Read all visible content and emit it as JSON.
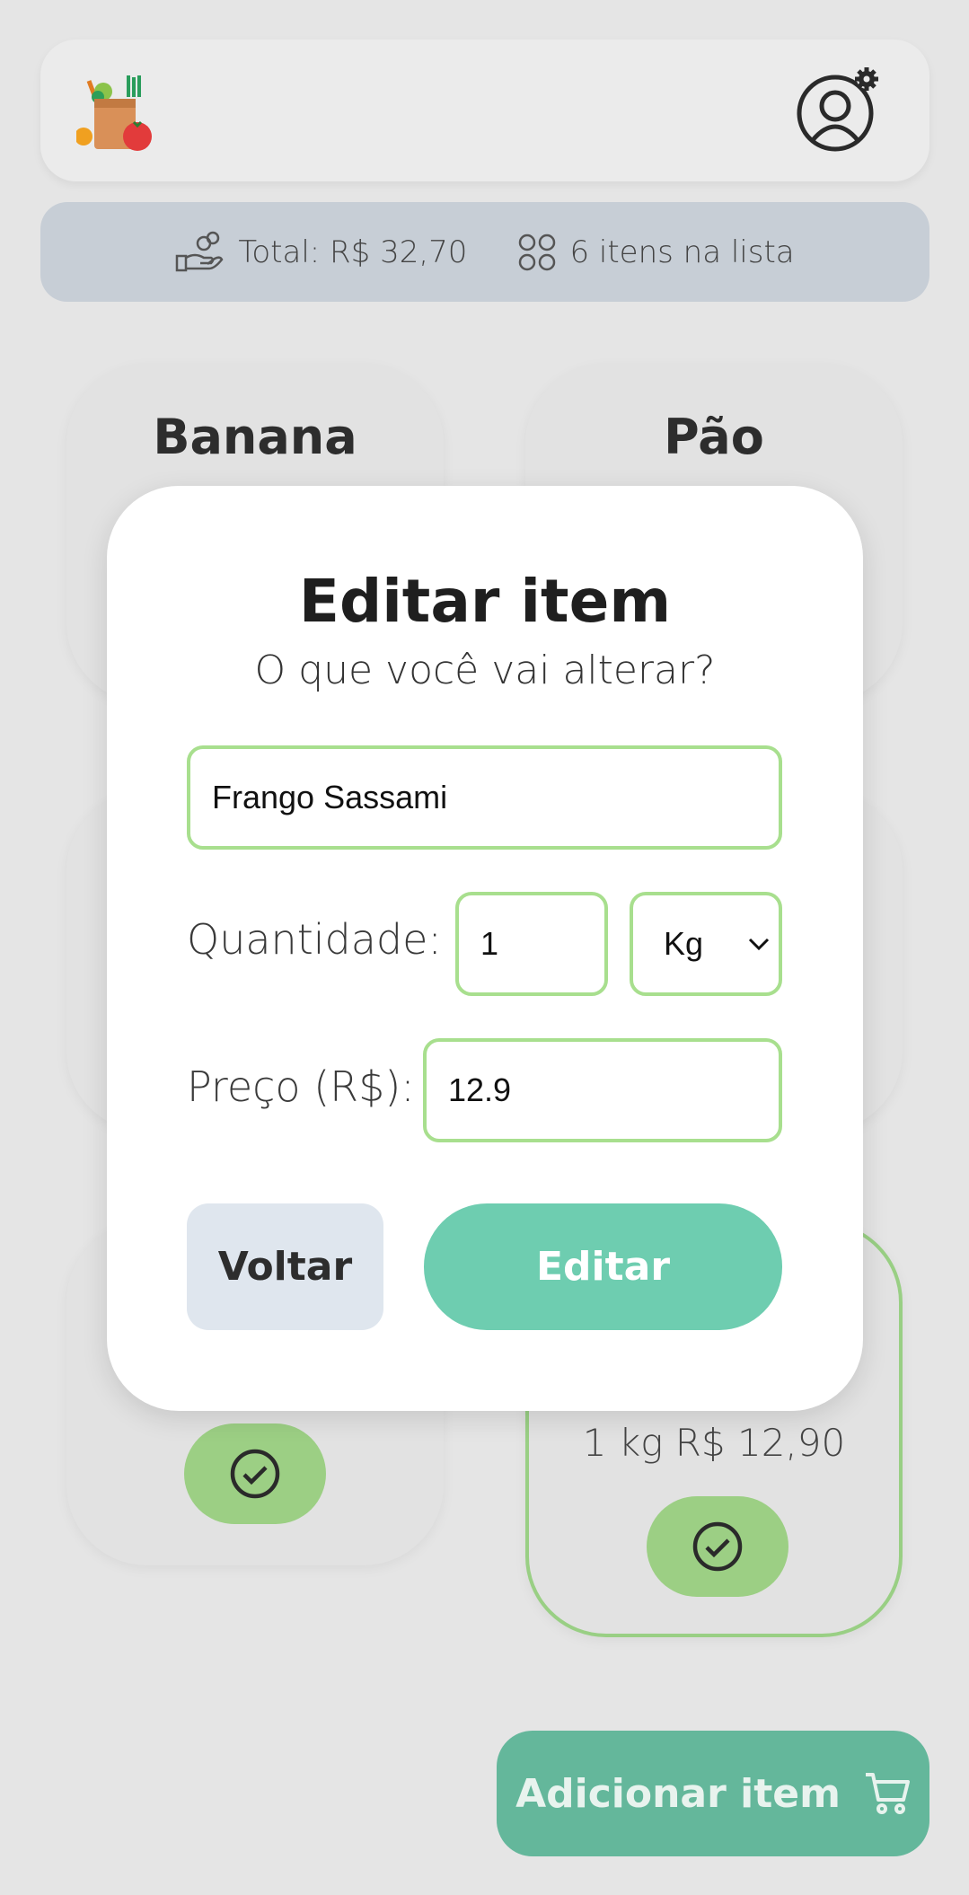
{
  "summary": {
    "total": "Total: R$ 32,70",
    "count": "6 itens na lista"
  },
  "cards": [
    {
      "title": "Banana"
    },
    {
      "title": "Pão"
    },
    {
      "info": "1 kg  R$ 12,90",
      "checked": true
    }
  ],
  "modal": {
    "title": "Editar item",
    "subtitle": "O que você vai alterar?",
    "name_value": "Frango Sassami",
    "quantity_label": "Quantidade:",
    "quantity_value": "1",
    "unit_value": "Kg",
    "price_label": "Preço (R$):",
    "price_value": "12.9",
    "back_label": "Voltar",
    "edit_label": "Editar"
  },
  "add_button": {
    "label": "Adicionar item"
  },
  "colors": {
    "accent": "#6ecdb0",
    "field_border": "#a8df8e",
    "check": "#9ccf84",
    "add_button": "#64b79b"
  },
  "icons": [
    "grocery-bag-icon",
    "user-settings-icon",
    "hand-coins-icon",
    "items-grid-icon",
    "check-circle-icon",
    "chevron-down-icon",
    "cart-icon"
  ]
}
